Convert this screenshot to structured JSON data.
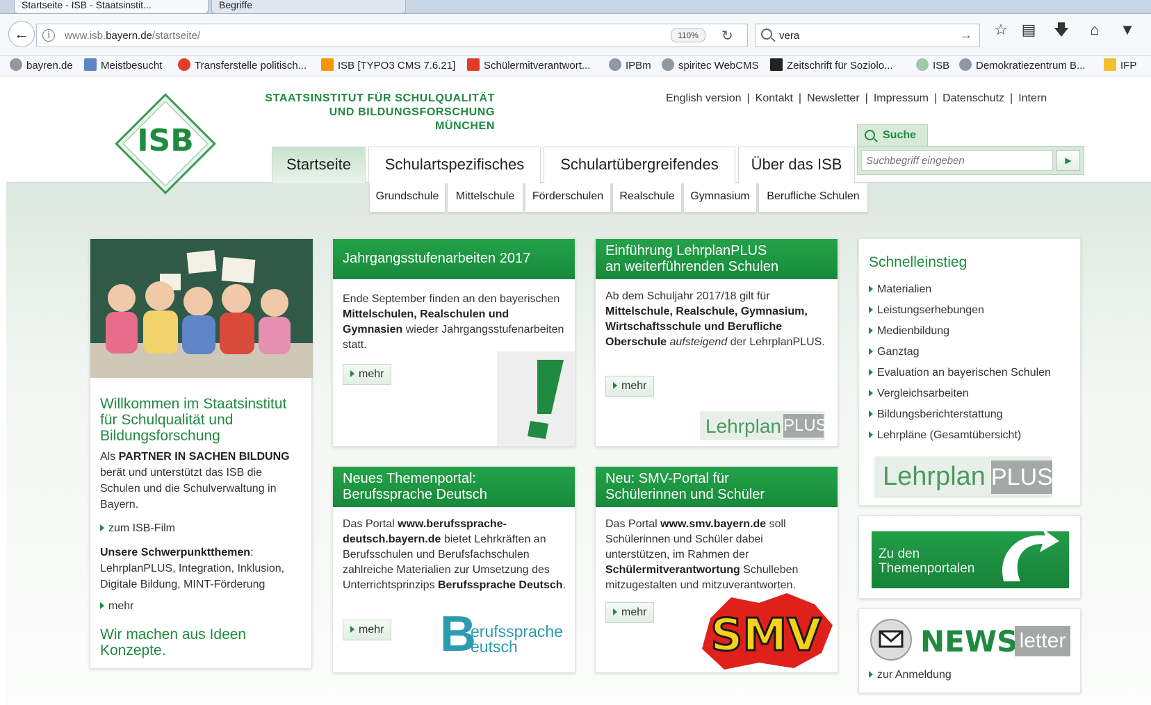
{
  "browser": {
    "tabs": [
      {
        "label": "Startseite - ISB - Staatsinstit..."
      },
      {
        "label": "Begriffe"
      }
    ],
    "url_prefix": "www.isb.",
    "url_domain": "bayern.de",
    "url_path": "/startseite/",
    "zoom": "110%",
    "search_value": "vera",
    "bookmarks": [
      "bayren.de",
      "Meistbesucht",
      "Transferstelle politisch...",
      "ISB [TYPO3 CMS 7.6.21]",
      "Schülermitverantwort...",
      "IPBm",
      "spiritec WebCMS",
      "Zeitschrift für Soziolo...",
      "ISB",
      "Demokratiezentrum B...",
      "IFP"
    ]
  },
  "site": {
    "logo_text": "ISB",
    "institute_name_line1": "STAATSINSTITUT FÜR SCHULQUALITÄT",
    "institute_name_line2": "UND BILDUNGSFORSCHUNG",
    "institute_name_line3": "MÜNCHEN",
    "top_links": [
      "English version",
      "Kontakt",
      "Newsletter",
      "Impressum",
      "Datenschutz",
      "Intern"
    ],
    "main_nav": [
      "Startseite",
      "Schulartspezifisches",
      "Schulartübergreifendes",
      "Über das ISB"
    ],
    "sub_nav": [
      "Grundschule",
      "Mittelschule",
      "Förderschulen",
      "Realschule",
      "Gymnasium",
      "Berufliche Schulen"
    ],
    "search_tab": "Suche",
    "search_placeholder": "Suchbegriff eingeben"
  },
  "welcome": {
    "title": "Willkommen im Staatsinstitut für Schulqualität und Bildungsforschung",
    "p1_a": "Als ",
    "p1_b": "PARTNER IN SACHEN BILDUNG",
    "p1_c": " berät und unterstützt das ISB die Schulen und die Schulverwaltung in Bayern.",
    "film_link": "zum ISB-Film",
    "focus_label": "Unsere Schwerpunktthemen",
    "focus_text": ": LehrplanPLUS, Integration, Inklusion, Digitale Bildung, MINT-Förderung",
    "mehr": "mehr",
    "slogan": "Wir machen aus Ideen Konzepte."
  },
  "card_jahrgang": {
    "title": "Jahrgangsstufenarbeiten 2017",
    "t1": "Ende September finden an den bayerischen ",
    "t2": "Mittelschulen, Realschulen und Gymnasien",
    "t3": " wieder Jahrgangsstufenarbeiten statt.",
    "mehr": "mehr",
    "image_glyph": "!"
  },
  "card_lehrplan": {
    "title_line1": "Einführung LehrplanPLUS",
    "title_line2": "an weiterführenden Schulen",
    "t1": "Ab dem Schuljahr 2017/18 gilt für ",
    "t2": "Mittelschule, Realschule, Gymnasium, Wirtschaftsschule und Berufliche Oberschule",
    "t3": " aufsteigend",
    "t4": " der LehrplanPLUS.",
    "mehr": "mehr",
    "logo_word": "Lehrplan",
    "logo_plus": "PLUS"
  },
  "card_beruf": {
    "title_line1": "Neues Themenportal:",
    "title_line2": "Berufssprache Deutsch",
    "t1": "Das Portal ",
    "t2": "www.berufssprache-deutsch.bayern.de",
    "t3": " bietet Lehrkräften an Berufsschulen und Berufsfachschulen zahlreiche Materialien zur Umsetzung des Unterrichtsprinzips ",
    "t4": "Berufssprache Deutsch",
    "t5": ".",
    "mehr": "mehr",
    "logo_big": "B",
    "logo_line1": "erufssprache",
    "logo_line2": "eutsch"
  },
  "card_smv": {
    "title_line1": "Neu: SMV-Portal für",
    "title_line2": "Schülerinnen und Schüler",
    "t1": "Das Portal ",
    "t2": "www.smv.bayern.de",
    "t3": " soll Schülerinnen und Schüler dabei unterstützen, im Rahmen der ",
    "t4": "Schülermitverantwortung",
    "t5": " Schulleben mitzugestalten und mitzuverantworten.",
    "mehr": "mehr",
    "logo_text": "SMV"
  },
  "schnelleinstieg": {
    "title": "Schnelleinstieg",
    "items": [
      "Materialien",
      "Leistungserhebungen",
      "Medienbildung",
      "Ganztag",
      "Evaluation an bayerischen Schulen",
      "Vergleichsarbeiten",
      "Bildungsberichterstattung",
      "Lehrpläne (Gesamtübersicht)"
    ],
    "logo_word": "Lehrplan",
    "logo_plus": "PLUS"
  },
  "themenportale": {
    "line1": "Zu den",
    "line2": "Themenportalen"
  },
  "newsletter": {
    "news": "NEWS",
    "letter": "letter",
    "link": "zur Anmeldung"
  },
  "colors": {
    "brand_green": "#1f8a40",
    "card_header_green": "#1a9140",
    "page_background": "#eaf1ec"
  }
}
